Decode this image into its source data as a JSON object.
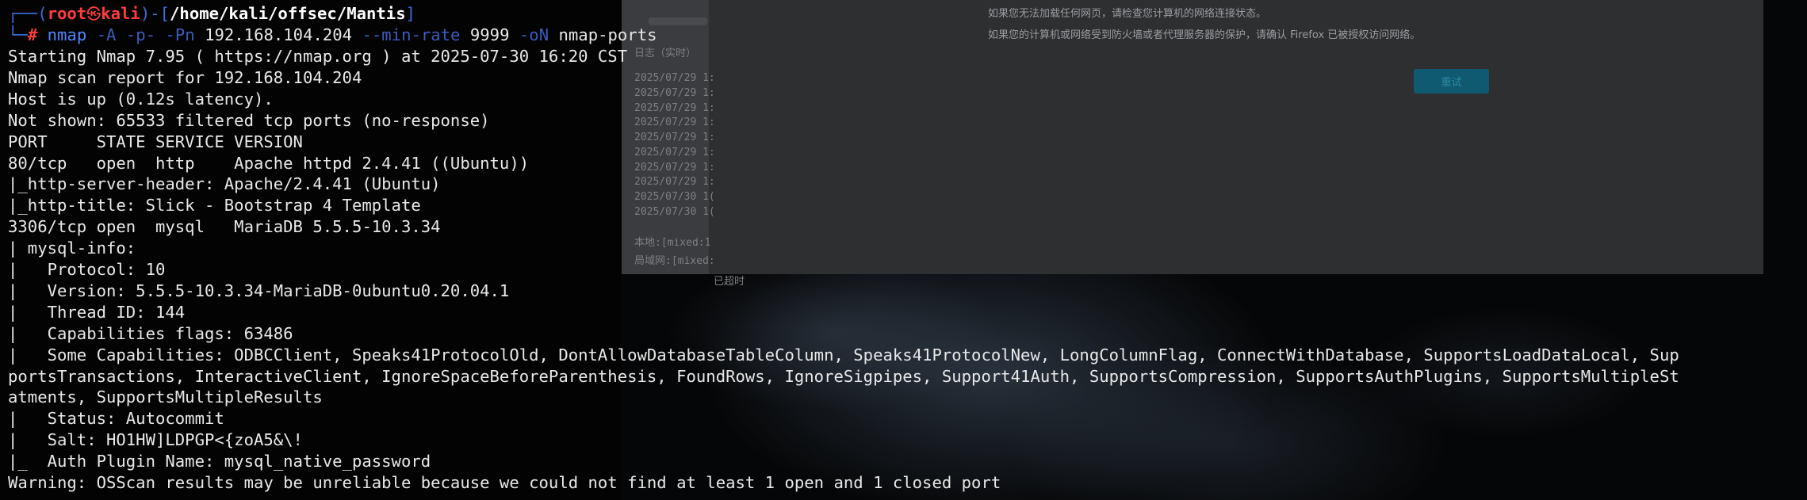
{
  "background_window": {
    "bullets": [
      "如果您无法加载任何网页，请检查您计算机的网络连接状态。",
      "如果您的计算机或网络受到防火墙或者代理服务器的保护，请确认 Firefox 已被授权访问网络。"
    ],
    "retry_button": "重试",
    "log_lines": [
      "日志（实时）",
      "2025/07/29 1:",
      "2025/07/29 1:",
      "2025/07/29 1:",
      "2025/07/29 1:",
      "2025/07/29 1:",
      "2025/07/29 1:",
      "2025/07/29 1:",
      "2025/07/29 1:",
      "2025/07/30 1(",
      "2025/07/30 1("
    ],
    "log_footer_local": "本地:[mixed:1",
    "log_footer_lan": "局域网:[mixed:",
    "timeout_label": "已超时"
  },
  "terminal": {
    "prompt": {
      "open": "┌──(",
      "user": "root",
      "skull": "㉿",
      "host": "kali",
      "mid": ")-[",
      "path": "/home/kali/offsec/Mantis",
      "close": "]",
      "corner": "└─",
      "hash": "#"
    },
    "command": {
      "program": "nmap",
      "args": [
        {
          "text": "-A",
          "kind": "opt"
        },
        {
          "text": "-p-",
          "kind": "opt"
        },
        {
          "text": "-Pn",
          "kind": "opt"
        },
        {
          "text": "192.168.104.204",
          "kind": "arg"
        },
        {
          "text": "--min-rate",
          "kind": "opt"
        },
        {
          "text": "9999",
          "kind": "arg"
        },
        {
          "text": "-oN",
          "kind": "opt"
        },
        {
          "text": "nmap-ports",
          "kind": "arg"
        }
      ]
    },
    "output": [
      "Starting Nmap 7.95 ( https://nmap.org ) at 2025-07-30 16:20 CST",
      "Nmap scan report for 192.168.104.204",
      "Host is up (0.12s latency).",
      "Not shown: 65533 filtered tcp ports (no-response)",
      "PORT     STATE SERVICE VERSION",
      "80/tcp   open  http    Apache httpd 2.4.41 ((Ubuntu))",
      "|_http-server-header: Apache/2.4.41 (Ubuntu)",
      "|_http-title: Slick - Bootstrap 4 Template",
      "3306/tcp open  mysql   MariaDB 5.5.5-10.3.34",
      "| mysql-info: ",
      "|   Protocol: 10",
      "|   Version: 5.5.5-10.3.34-MariaDB-0ubuntu0.20.04.1",
      "|   Thread ID: 144",
      "|   Capabilities flags: 63486",
      "|   Some Capabilities: ODBCClient, Speaks41ProtocolOld, DontAllowDatabaseTableColumn, Speaks41ProtocolNew, LongColumnFlag, ConnectWithDatabase, SupportsLoadDataLocal, Sup",
      "portsTransactions, InteractiveClient, IgnoreSpaceBeforeParenthesis, FoundRows, IgnoreSigpipes, Support41Auth, SupportsCompression, SupportsAuthPlugins, SupportsMultipleSt",
      "atments, SupportsMultipleResults",
      "|   Status: Autocommit",
      "|   Salt: HO1HW]LDPGP<{zoA5&\\!",
      "|_  Auth Plugin Name: mysql_native_password",
      "Warning: OSScan results may be unreliable because we could not find at least 1 open and 1 closed port"
    ]
  }
}
